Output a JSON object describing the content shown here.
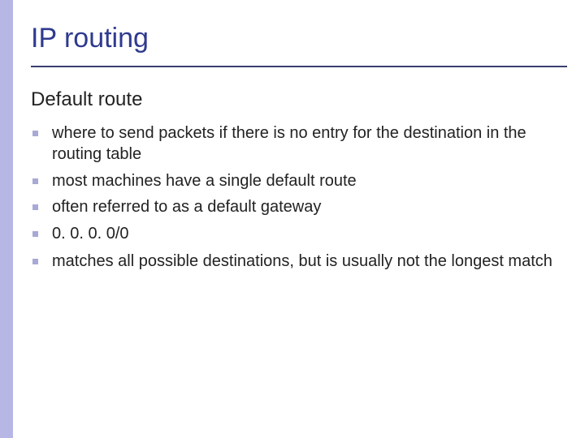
{
  "title": "IP routing",
  "subtitle": "Default route",
  "bullets": [
    {
      "text": "where to send packets if there is no entry for the destination in the routing table"
    },
    {
      "text": "most machines have a single default route"
    },
    {
      "text": "often referred to as a default gateway"
    },
    {
      "text": "0. 0. 0. 0/0"
    },
    {
      "text": "matches all possible destinations, but is usually not the longest match"
    }
  ]
}
